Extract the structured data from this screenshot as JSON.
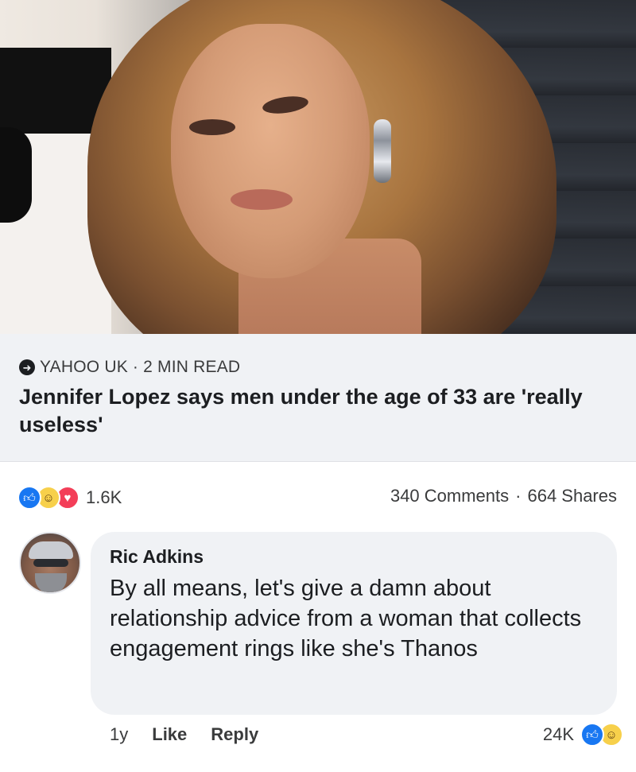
{
  "post": {
    "link_preview": {
      "source": "YAHOO UK",
      "separator": "·",
      "read_time": "2 MIN READ",
      "headline": "Jennifer Lopez says men under the age of 33 are 'really useless'"
    },
    "reactions": {
      "icons": [
        "like-icon",
        "haha-icon",
        "love-icon"
      ],
      "count": "1.6K"
    },
    "engagement": {
      "comments": "340 Comments",
      "separator": "·",
      "shares": "664 Shares"
    }
  },
  "comment": {
    "author": "Ric Adkins",
    "text": "By all means,  let's give a damn about relationship advice from a woman that collects engagement rings like she's Thanos",
    "age": "1y",
    "like_label": "Like",
    "reply_label": "Reply",
    "reaction_count": "24K",
    "reaction_icons": [
      "like-icon",
      "haha-icon"
    ]
  },
  "colors": {
    "like_blue": "#1877f2",
    "haha_yellow": "#f7d04b",
    "love_red": "#f33e58",
    "page_bg": "#f0f2f5",
    "text_primary": "#1c1e21",
    "text_secondary": "#3a3b3c"
  }
}
